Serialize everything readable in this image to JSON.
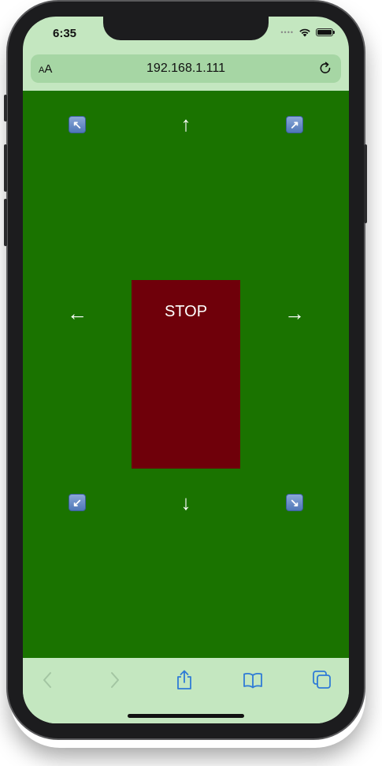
{
  "status_bar": {
    "time": "6:35",
    "signal_dots": "••••"
  },
  "address_bar": {
    "text_size_small": "A",
    "text_size_large": "A",
    "url": "192.168.1.111"
  },
  "controls": {
    "up": "↑",
    "down": "↓",
    "left": "←",
    "right": "→",
    "up_left": "↖",
    "up_right": "↗",
    "down_left": "↙",
    "down_right": "↘",
    "stop": "STOP"
  },
  "colors": {
    "page_background": "#1a7300",
    "stop_background": "#6f000a",
    "browser_chrome": "#c4e7c0",
    "address_bar": "#a6d6a4",
    "toolbar_accent": "#2f7bd6",
    "toolbar_disabled": "#a3c5a2"
  },
  "toolbar": {
    "icons": [
      "back-icon",
      "forward-icon",
      "share-icon",
      "bookmarks-icon",
      "tabs-icon"
    ]
  }
}
